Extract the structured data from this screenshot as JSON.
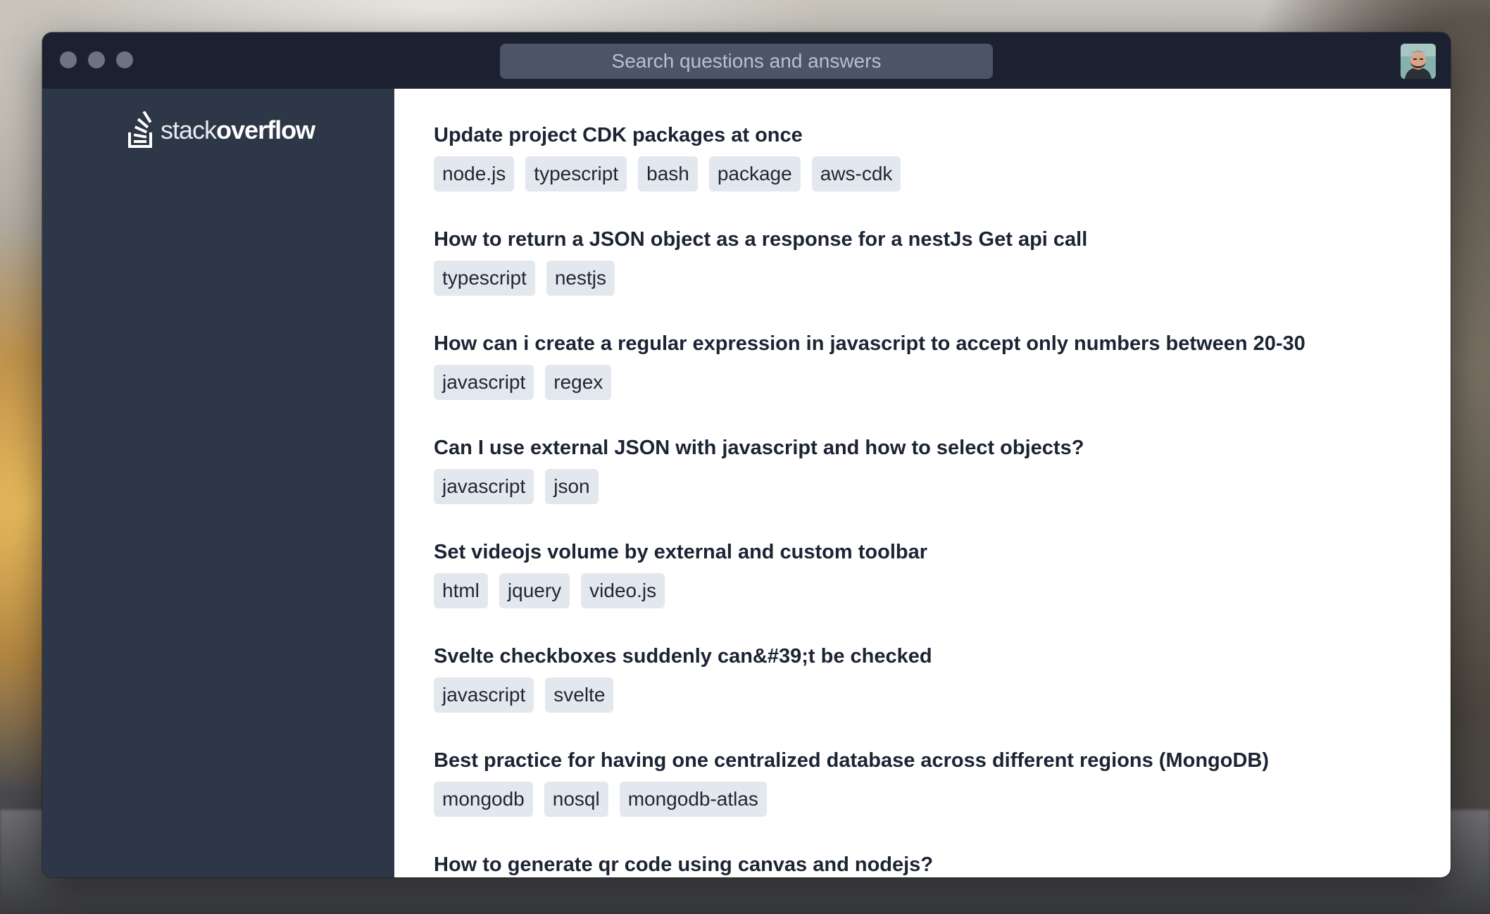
{
  "search": {
    "placeholder": "Search questions and answers"
  },
  "sidebar": {
    "logo": {
      "light": "stack",
      "bold": "overflow"
    }
  },
  "colors": {
    "titlebar": "#1b2130",
    "sidebar": "#2e3748",
    "content": "#ffffff",
    "tag_bg": "#e3e8ef",
    "search_bg": "#4b5567"
  },
  "icons": {
    "logo": "stackoverflow-logo-icon",
    "avatar": "user-avatar"
  },
  "questions": [
    {
      "title": "Update project CDK packages at once",
      "tags": [
        "node.js",
        "typescript",
        "bash",
        "package",
        "aws-cdk"
      ]
    },
    {
      "title": "How to return a JSON object as a response for a nestJs Get api call",
      "tags": [
        "typescript",
        "nestjs"
      ]
    },
    {
      "title": "How can i create a regular expression in javascript to accept only numbers between 20-30",
      "tags": [
        "javascript",
        "regex"
      ]
    },
    {
      "title": "Can I use external JSON with javascript and how to select objects?",
      "tags": [
        "javascript",
        "json"
      ]
    },
    {
      "title": "Set videojs volume by external and custom toolbar",
      "tags": [
        "html",
        "jquery",
        "video.js"
      ]
    },
    {
      "title": "Svelte checkboxes suddenly can&#39;t be checked",
      "tags": [
        "javascript",
        "svelte"
      ]
    },
    {
      "title": "Best practice for having one centralized database across different regions (MongoDB)",
      "tags": [
        "mongodb",
        "nosql",
        "mongodb-atlas"
      ]
    },
    {
      "title": "How to generate qr code using canvas and nodejs?",
      "tags": []
    }
  ]
}
